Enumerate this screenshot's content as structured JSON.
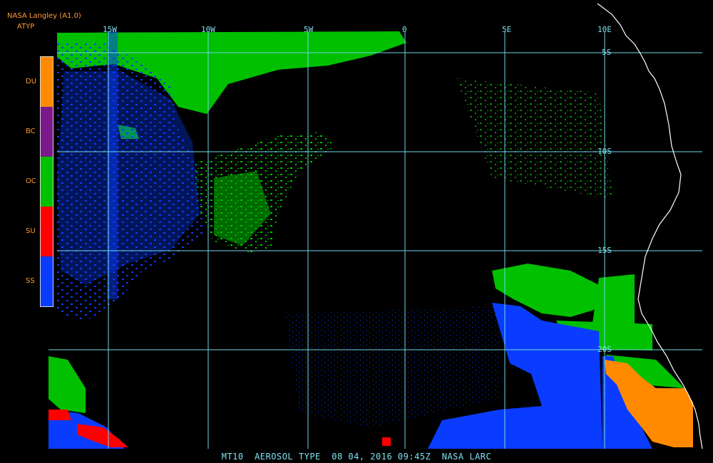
{
  "header": {
    "line1": "NASA Langley (A1.0)",
    "line2": "ATYP"
  },
  "legend": [
    {
      "code": "DU",
      "color": "#ff8a00"
    },
    {
      "code": "BC",
      "color": "#7a1a8a"
    },
    {
      "code": "OC",
      "color": "#00c000"
    },
    {
      "code": "SU",
      "color": "#ff0000"
    },
    {
      "code": "SS",
      "color": "#0a3cff"
    }
  ],
  "grid": {
    "lon_labels": [
      "15W",
      "10W",
      "5W",
      "0",
      "5E",
      "10E"
    ],
    "lat_labels": [
      "5S",
      "10S",
      "15S",
      "20S"
    ],
    "line_color": "#6fd6e6",
    "coast_color": "#ffffff"
  },
  "footer": "MT10  AEROSOL TYPE  08 04, 2016 09:45Z  NASA LARC"
}
